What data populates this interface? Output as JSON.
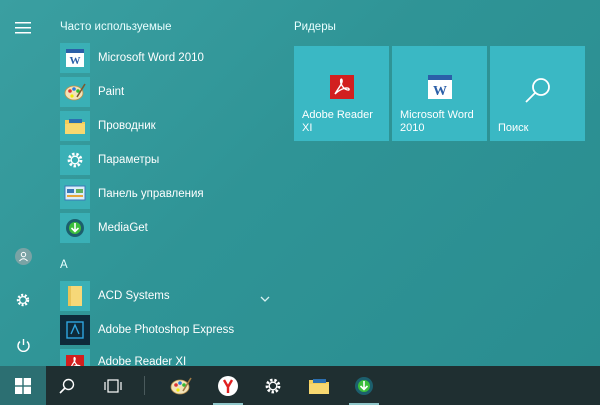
{
  "rail": {
    "menu_icon": "hamburger-icon",
    "user_icon": "user-icon",
    "settings_icon": "gear-icon",
    "power_icon": "power-icon"
  },
  "applist": {
    "frequent_header": "Часто используемые",
    "frequent": [
      {
        "label": "Microsoft Word 2010",
        "icon": "word-icon"
      },
      {
        "label": "Paint",
        "icon": "paint-icon"
      },
      {
        "label": "Проводник",
        "icon": "folder-icon"
      },
      {
        "label": "Параметры",
        "icon": "gear-icon"
      },
      {
        "label": "Панель управления",
        "icon": "control-panel-icon"
      },
      {
        "label": "MediaGet",
        "icon": "mediaget-icon"
      }
    ],
    "letter_header": "A",
    "letter_items": [
      {
        "label": "ACD Systems",
        "icon": "folder-icon",
        "expandable": true
      },
      {
        "label": "Adobe Photoshop Express",
        "icon": "photoshop-icon"
      },
      {
        "label": "Adobe Reader XI",
        "icon": "adobe-reader-icon"
      }
    ]
  },
  "tiles": {
    "header": "Ридеры",
    "items": [
      {
        "label": "Adobe Reader XI",
        "icon": "adobe-reader-icon"
      },
      {
        "label": "Microsoft Word 2010",
        "icon": "word-icon"
      },
      {
        "label": "Поиск",
        "icon": "search-icon"
      }
    ]
  },
  "taskbar": {
    "items": [
      "windows-icon",
      "search-icon",
      "task-view-icon",
      "paint-icon",
      "yandex-icon",
      "gear-icon",
      "folder-icon",
      "mediaget-icon"
    ]
  },
  "colors": {
    "background": "#2f9496",
    "tile": "#3ab8c4",
    "app_tile": "#3ab0b6",
    "taskbar": "#1f2f31",
    "adobe_red": "#d21f1f",
    "word_blue": "#2b5fa8"
  }
}
